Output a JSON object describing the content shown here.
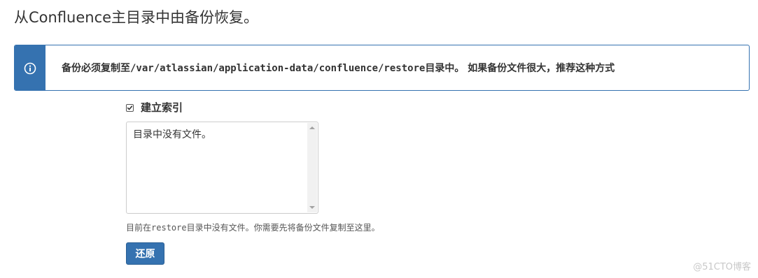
{
  "page": {
    "title": "从Confluence主目录中由备份恢复。"
  },
  "info_message": {
    "prefix": "备份必须复制至",
    "path": "/var/atlassian/application-data/confluence/restore",
    "suffix": "目录中。 如果备份文件很大，推荐这种方式",
    "icon": "info-icon",
    "accent_color": "#3572b0"
  },
  "form": {
    "build_index": {
      "label": "建立索引",
      "checked": true
    },
    "file_list": {
      "value": "目录中没有文件。"
    },
    "help": {
      "prefix": "目前在",
      "dir": "restore",
      "suffix": "目录中没有文件。你需要先将备份文件复制至这里。"
    },
    "restore_button_label": "还原"
  },
  "watermark": "@51CTO博客"
}
